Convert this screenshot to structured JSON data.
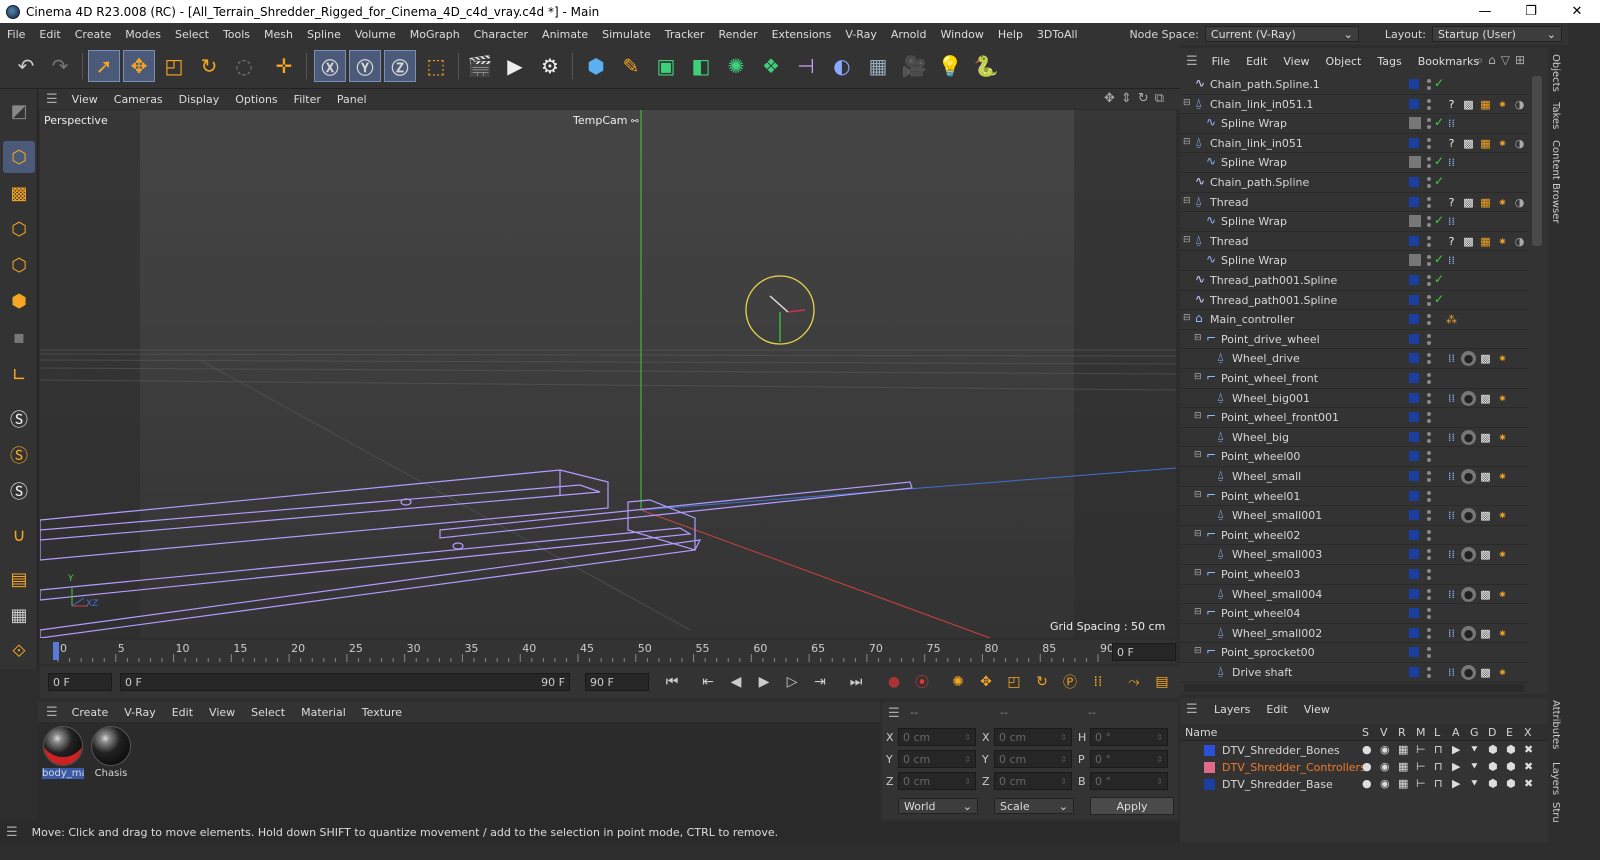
{
  "window": {
    "title": "Cinema 4D R23.008 (RC) - [All_Terrain_Shredder_Rigged_for_Cinema_4D_c4d_vray.c4d *] - Main",
    "minimize": "—",
    "maximize": "❐",
    "close": "✕"
  },
  "menubar": {
    "items": [
      "File",
      "Edit",
      "Create",
      "Modes",
      "Select",
      "Tools",
      "Mesh",
      "Spline",
      "Volume",
      "MoGraph",
      "Character",
      "Animate",
      "Simulate",
      "Tracker",
      "Render",
      "Extensions",
      "V-Ray",
      "Arnold",
      "Window",
      "Help",
      "3DToAll"
    ],
    "node_space_label": "Node Space:",
    "node_space_value": "Current (V-Ray)",
    "layout_label": "Layout:",
    "layout_value": "Startup (User)"
  },
  "viewport": {
    "menu": [
      "View",
      "Cameras",
      "Display",
      "Options",
      "Filter",
      "Panel"
    ],
    "label": "Perspective",
    "camera": "TempCam",
    "grid_spacing": "Grid Spacing : 50 cm",
    "axis_y": "Y",
    "axis_xz": "XZ"
  },
  "timeline": {
    "ticks": [
      "0",
      "5",
      "10",
      "15",
      "20",
      "25",
      "30",
      "35",
      "40",
      "45",
      "50",
      "55",
      "60",
      "65",
      "70",
      "75",
      "80",
      "85",
      "90"
    ],
    "current_frame": "0 F"
  },
  "transport": {
    "start_field": "0 F",
    "range_start": "0 F",
    "range_end": "90 F",
    "end_field": "90 F"
  },
  "materials": {
    "menu": [
      "Create",
      "V-Ray",
      "Edit",
      "View",
      "Select",
      "Material",
      "Texture"
    ],
    "items": [
      {
        "name": "body_ma"
      },
      {
        "name": "Chasis"
      }
    ]
  },
  "coordinates": {
    "headers": [
      "--",
      "--",
      "--"
    ],
    "rows": [
      {
        "a": "X",
        "av": "0 cm",
        "b": "X",
        "bv": "0 cm",
        "c": "H",
        "cv": "0 °"
      },
      {
        "a": "Y",
        "av": "0 cm",
        "b": "Y",
        "bv": "0 cm",
        "c": "P",
        "cv": "0 °"
      },
      {
        "a": "Z",
        "av": "0 cm",
        "b": "Z",
        "bv": "0 cm",
        "c": "B",
        "cv": "0 °"
      }
    ],
    "world": "World",
    "scale": "Scale",
    "apply": "Apply"
  },
  "objects": {
    "menu": [
      "File",
      "Edit",
      "View",
      "Object",
      "Tags",
      "Bookmarks"
    ],
    "rows": [
      {
        "name": "Chain_path.Spline.1",
        "depth": 0,
        "icon": "spline",
        "check": true,
        "tags": ""
      },
      {
        "name": "Chain_link_in051.1",
        "depth": 0,
        "icon": "bone",
        "check": false,
        "tags": "rig",
        "expand": true
      },
      {
        "name": "Spline Wrap",
        "depth": 1,
        "icon": "wrap",
        "check": true,
        "tags": "dots"
      },
      {
        "name": "Chain_link_in051",
        "depth": 0,
        "icon": "bone",
        "check": false,
        "tags": "rig",
        "expand": true
      },
      {
        "name": "Spline Wrap",
        "depth": 1,
        "icon": "wrap",
        "check": true,
        "tags": "dots"
      },
      {
        "name": "Chain_path.Spline",
        "depth": 0,
        "icon": "spline",
        "check": true,
        "tags": ""
      },
      {
        "name": "Thread",
        "depth": 0,
        "icon": "bone",
        "check": false,
        "tags": "rig",
        "expand": true
      },
      {
        "name": "Spline Wrap",
        "depth": 1,
        "icon": "wrap",
        "check": true,
        "tags": "dots"
      },
      {
        "name": "Thread",
        "depth": 0,
        "icon": "bone",
        "check": false,
        "tags": "rig",
        "expand": true
      },
      {
        "name": "Spline Wrap",
        "depth": 1,
        "icon": "wrap",
        "check": true,
        "tags": "dots"
      },
      {
        "name": "Thread_path001.Spline",
        "depth": 0,
        "icon": "spline",
        "check": true,
        "tags": ""
      },
      {
        "name": "Thread_path001.Spline",
        "depth": 0,
        "icon": "spline",
        "check": true,
        "tags": ""
      },
      {
        "name": "Main_controller",
        "depth": 0,
        "icon": "null",
        "check": false,
        "tags": "ctrl",
        "expand": true
      },
      {
        "name": "Point_drive_wheel",
        "depth": 1,
        "icon": "point",
        "check": false,
        "tags": "",
        "expand": true
      },
      {
        "name": "Wheel_drive",
        "depth": 2,
        "icon": "bone",
        "check": false,
        "tags": "wheel"
      },
      {
        "name": "Point_wheel_front",
        "depth": 1,
        "icon": "point",
        "check": false,
        "tags": "",
        "expand": true
      },
      {
        "name": "Wheel_big001",
        "depth": 2,
        "icon": "bone",
        "check": false,
        "tags": "wheel"
      },
      {
        "name": "Point_wheel_front001",
        "depth": 1,
        "icon": "point",
        "check": false,
        "tags": "",
        "expand": true
      },
      {
        "name": "Wheel_big",
        "depth": 2,
        "icon": "bone",
        "check": false,
        "tags": "wheel"
      },
      {
        "name": "Point_wheel00",
        "depth": 1,
        "icon": "point",
        "check": false,
        "tags": "",
        "expand": true
      },
      {
        "name": "Wheel_small",
        "depth": 2,
        "icon": "bone",
        "check": false,
        "tags": "wheel"
      },
      {
        "name": "Point_wheel01",
        "depth": 1,
        "icon": "point",
        "check": false,
        "tags": "",
        "expand": true
      },
      {
        "name": "Wheel_small001",
        "depth": 2,
        "icon": "bone",
        "check": false,
        "tags": "wheel"
      },
      {
        "name": "Point_wheel02",
        "depth": 1,
        "icon": "point",
        "check": false,
        "tags": "",
        "expand": true
      },
      {
        "name": "Wheel_small003",
        "depth": 2,
        "icon": "bone",
        "check": false,
        "tags": "wheel"
      },
      {
        "name": "Point_wheel03",
        "depth": 1,
        "icon": "point",
        "check": false,
        "tags": "",
        "expand": true
      },
      {
        "name": "Wheel_small004",
        "depth": 2,
        "icon": "bone",
        "check": false,
        "tags": "wheel"
      },
      {
        "name": "Point_wheel04",
        "depth": 1,
        "icon": "point",
        "check": false,
        "tags": "",
        "expand": true
      },
      {
        "name": "Wheel_small002",
        "depth": 2,
        "icon": "bone",
        "check": false,
        "tags": "wheel"
      },
      {
        "name": "Point_sprocket00",
        "depth": 1,
        "icon": "point",
        "check": false,
        "tags": "",
        "expand": true
      },
      {
        "name": "Drive shaft",
        "depth": 2,
        "icon": "bone",
        "check": false,
        "tags": "wheel"
      }
    ]
  },
  "layers": {
    "menu": [
      "Layers",
      "Edit",
      "View"
    ],
    "name_header": "Name",
    "col_headers": [
      "S",
      "V",
      "R",
      "M",
      "L",
      "A",
      "G",
      "D",
      "E",
      "X"
    ],
    "rows": [
      {
        "name": "DTV_Shredder_Bones",
        "color": "#2a4fd8",
        "text_color": "#d6d6d6"
      },
      {
        "name": "DTV_Shredder_Controllers",
        "color": "#e06a8a",
        "text_color": "#f07a2a"
      },
      {
        "name": "DTV_Shredder_Base",
        "color": "#1a3fa0",
        "text_color": "#d6d6d6"
      }
    ]
  },
  "side_tabs": [
    "Objects",
    "Takes",
    "Content Browser",
    "Attributes",
    "Layers",
    "Stru"
  ],
  "status": "Move: Click and drag to move elements. Hold down SHIFT to quantize movement / add to the selection in point mode, CTRL to remove.",
  "colors": {
    "accent": "#4a5a78",
    "selection_outline": "#b39cff",
    "x_axis": "#d04040",
    "y_axis": "#40c040",
    "z_axis": "#4070d0",
    "null_circle": "#e8d44a"
  }
}
